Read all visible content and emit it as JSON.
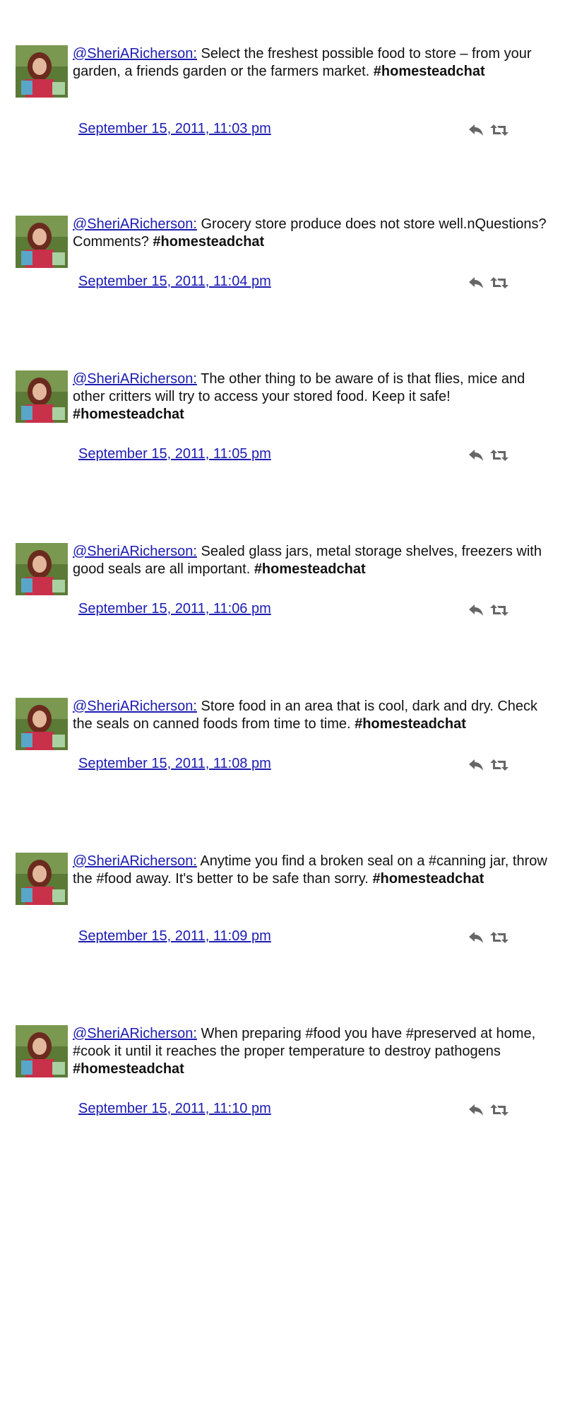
{
  "tweets": [
    {
      "handle": "@SheriARicherson:",
      "text": " Select the freshest possible food to store – from your garden, a friends garden or the farmers market. ",
      "hashtag": "#homesteadchat",
      "date": "September 15, 2011, 11:03 pm"
    },
    {
      "handle": "@SheriARicherson:",
      "text": " Grocery store produce does not store well.nQuestions? Comments? ",
      "hashtag": "#homesteadchat",
      "date": "September 15, 2011, 11:04 pm"
    },
    {
      "handle": "@SheriARicherson:",
      "text": " The other thing to be aware of is that flies, mice and other critters will try to access your stored food. Keep it safe! ",
      "hashtag": "#homesteadchat",
      "date": "September 15, 2011, 11:05 pm"
    },
    {
      "handle": "@SheriARicherson:",
      "text": " Sealed glass jars, metal storage shelves, freezers with good seals are all important. ",
      "hashtag": "#homesteadchat",
      "date": "September 15, 2011, 11:06 pm"
    },
    {
      "handle": "@SheriARicherson:",
      "text": " Store food in an area that is cool, dark and dry. Check the seals on canned foods from time to time. ",
      "hashtag": "#homesteadchat",
      "date": "September 15, 2011, 11:08 pm"
    },
    {
      "handle": "@SheriARicherson:",
      "text": " Anytime you find a broken seal on a #canning jar, throw the #food away. It's better to be safe than sorry. ",
      "hashtag": "#homesteadchat",
      "date": "September 15, 2011, 11:09 pm"
    },
    {
      "handle": "@SheriARicherson:",
      "text": " When preparing #food you have #preserved at home, #cook it until it reaches the proper temperature to destroy pathogens ",
      "hashtag": "#homesteadchat",
      "date": "September 15, 2011, 11:10 pm"
    }
  ],
  "icons": {
    "reply": "reply-icon",
    "retweet": "retweet-icon"
  },
  "colors": {
    "link": "#1b1bb0",
    "text": "#111111",
    "icon": "#666666"
  }
}
